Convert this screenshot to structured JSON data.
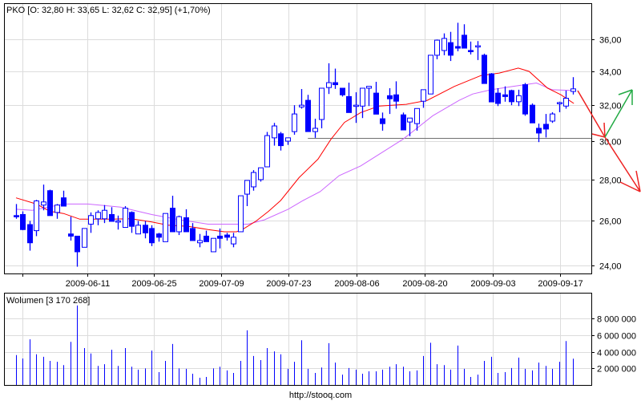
{
  "header": {
    "title": "PKO [O: 32,80  H: 33,65  L: 32,62  C: 32,95] (+1,70%)",
    "volume_title": "Wolumen [3 170 268]",
    "footer": "http://stooq.com"
  },
  "colors": {
    "candle": "#0000ff",
    "ma_short": "#ff0000",
    "ma_long": "#cc66ff",
    "support": "#707070",
    "arrow_down": "#ee2222",
    "arrow_up": "#22aa44",
    "grid": "#dcdcdc"
  },
  "chart_data": [
    {
      "type": "candlestick",
      "title": "PKO",
      "scale": "log",
      "ylim": [
        23.6,
        37.5
      ],
      "y_ticks": [
        {
          "v": 24,
          "label": "24,00"
        },
        {
          "v": 26,
          "label": "26,00"
        },
        {
          "v": 28,
          "label": "28,00"
        },
        {
          "v": 30,
          "label": "30,00"
        },
        {
          "v": 32,
          "label": "32,00"
        },
        {
          "v": 34,
          "label": "34,00"
        },
        {
          "v": 36,
          "label": "36,00"
        }
      ],
      "x_ticks": [
        {
          "i": 0.95,
          "label": ""
        },
        {
          "i": 10.5,
          "label": "2009-06-11"
        },
        {
          "i": 20.3,
          "label": "2009-06-25"
        },
        {
          "i": 30.2,
          "label": "2009-07-09"
        },
        {
          "i": 40.2,
          "label": "2009-07-23"
        },
        {
          "i": 50.2,
          "label": "2009-08-06"
        },
        {
          "i": 60.2,
          "label": "2009-08-20"
        },
        {
          "i": 70.2,
          "label": "2009-09-03"
        },
        {
          "i": 80.2,
          "label": "2009-09-17"
        }
      ],
      "ohlc": [
        [
          26.25,
          26.8,
          26.1,
          26.2
        ],
        [
          26.3,
          26.45,
          25.57,
          25.6
        ],
        [
          25.83,
          26.0,
          24.65,
          25.0
        ],
        [
          25.55,
          27.0,
          25.3,
          26.95
        ],
        [
          26.75,
          27.75,
          26.5,
          26.9
        ],
        [
          27.45,
          27.5,
          26.25,
          26.25
        ],
        [
          26.4,
          26.8,
          26.1,
          26.75
        ],
        [
          27.1,
          27.45,
          26.7,
          26.7
        ],
        [
          25.4,
          26.2,
          25.1,
          25.3
        ],
        [
          25.3,
          25.3,
          23.95,
          24.6
        ],
        [
          24.8,
          25.65,
          24.8,
          25.65
        ],
        [
          25.85,
          26.4,
          25.45,
          26.25
        ],
        [
          26.1,
          26.5,
          25.8,
          26.4
        ],
        [
          26.1,
          26.75,
          25.9,
          26.5
        ],
        [
          26.3,
          26.65,
          25.98,
          25.98
        ],
        [
          26.0,
          26.25,
          25.6,
          26.0
        ],
        [
          25.7,
          26.7,
          25.7,
          26.6
        ],
        [
          26.4,
          26.45,
          25.45,
          25.75
        ],
        [
          25.4,
          26.0,
          25.4,
          25.8
        ],
        [
          25.8,
          26.0,
          25.2,
          25.45
        ],
        [
          25.65,
          25.8,
          24.85,
          25.0
        ],
        [
          25.4,
          25.45,
          25.05,
          25.25
        ],
        [
          25.05,
          26.35,
          25.05,
          26.35
        ],
        [
          26.6,
          27.2,
          25.5,
          25.5
        ],
        [
          25.5,
          26.25,
          25.35,
          26.2
        ],
        [
          26.15,
          26.55,
          25.5,
          25.5
        ],
        [
          25.65,
          25.9,
          25.1,
          25.1
        ],
        [
          25.0,
          25.4,
          24.8,
          25.1
        ],
        [
          25.3,
          25.55,
          25.05,
          25.05
        ],
        [
          24.6,
          25.2,
          24.6,
          25.2
        ],
        [
          25.3,
          25.65,
          24.75,
          25.2
        ],
        [
          25.35,
          25.45,
          25.1,
          25.25
        ],
        [
          24.95,
          25.45,
          24.8,
          25.25
        ],
        [
          25.5,
          27.2,
          25.5,
          27.2
        ],
        [
          27.28,
          27.96,
          26.7,
          27.96
        ],
        [
          27.64,
          28.48,
          27.45,
          28.36
        ],
        [
          28.0,
          28.6,
          27.9,
          28.6
        ],
        [
          28.65,
          30.5,
          28.65,
          30.3
        ],
        [
          30.18,
          31.0,
          29.76,
          30.83
        ],
        [
          30.4,
          30.5,
          29.5,
          29.76
        ],
        [
          30.0,
          30.2,
          29.8,
          30.18
        ],
        [
          30.52,
          32.0,
          30.35,
          31.5
        ],
        [
          31.9,
          32.94,
          31.8,
          32.0
        ],
        [
          32.28,
          32.6,
          30.52,
          30.52
        ],
        [
          30.52,
          31.23,
          30.18,
          30.7
        ],
        [
          31.19,
          32.99,
          30.7,
          32.99
        ],
        [
          33.03,
          34.5,
          32.65,
          33.32
        ],
        [
          33.32,
          34.17,
          32.95,
          33.2
        ],
        [
          32.99,
          32.99,
          32.5,
          32.6
        ],
        [
          32.5,
          33.32,
          31.58,
          31.58
        ],
        [
          32.0,
          32.75,
          31.0,
          32.0
        ],
        [
          31.95,
          32.99,
          31.27,
          32.99
        ],
        [
          32.99,
          33.1,
          31.95,
          33.1
        ],
        [
          32.7,
          33.37,
          31.49,
          31.49
        ],
        [
          31.23,
          31.58,
          30.57,
          30.96
        ],
        [
          32.55,
          32.99,
          31.5,
          32.37
        ],
        [
          32.6,
          33.4,
          31.8,
          32.23
        ],
        [
          31.45,
          31.58,
          30.61,
          30.61
        ],
        [
          31.05,
          31.27,
          30.27,
          31.27
        ],
        [
          30.96,
          31.81,
          30.57,
          31.81
        ],
        [
          32.23,
          32.9,
          31.85,
          32.9
        ],
        [
          32.65,
          35.0,
          32.65,
          35.0
        ],
        [
          35.0,
          36.0,
          34.75,
          35.96
        ],
        [
          35.3,
          36.4,
          35.0,
          36.07
        ],
        [
          35.8,
          36.5,
          34.64,
          35.0
        ],
        [
          35.55,
          37.1,
          35.25,
          35.45
        ],
        [
          36.28,
          37.0,
          35.45,
          35.45
        ],
        [
          35.3,
          35.87,
          35.05,
          35.28
        ],
        [
          35.6,
          35.9,
          34.7,
          35.6
        ],
        [
          35.0,
          35.1,
          33.27,
          33.27
        ],
        [
          33.85,
          33.9,
          32.19,
          32.19
        ],
        [
          32.7,
          32.99,
          31.95,
          32.1
        ],
        [
          32.6,
          33.1,
          32.2,
          32.5
        ],
        [
          32.85,
          32.9,
          32.0,
          32.2
        ],
        [
          32.2,
          32.9,
          31.95,
          32.55
        ],
        [
          33.2,
          33.3,
          31.4,
          31.5
        ],
        [
          32.0,
          32.1,
          31.0,
          31.0
        ],
        [
          30.7,
          30.96,
          29.95,
          30.44
        ],
        [
          30.92,
          31.5,
          30.2,
          30.66
        ],
        [
          31.1,
          31.6,
          31.0,
          31.5
        ],
        [
          32.1,
          32.2,
          31.6,
          32.15
        ],
        [
          31.95,
          32.85,
          31.8,
          32.4
        ],
        [
          32.8,
          33.65,
          32.62,
          32.95
        ]
      ],
      "ma_short": [
        [
          0,
          27.1
        ],
        [
          3,
          26.8
        ],
        [
          5,
          26.45
        ],
        [
          7,
          26.35
        ],
        [
          9.4,
          26.08
        ],
        [
          14,
          26.08
        ],
        [
          17,
          26.1
        ],
        [
          20,
          25.95
        ],
        [
          22.4,
          25.8
        ],
        [
          25.4,
          25.75
        ],
        [
          28.3,
          25.6
        ],
        [
          30.7,
          25.5
        ],
        [
          32.5,
          25.5
        ],
        [
          33.6,
          25.65
        ],
        [
          35.4,
          26.0
        ],
        [
          37.2,
          26.45
        ],
        [
          39,
          26.97
        ],
        [
          41.7,
          28.1
        ],
        [
          44.5,
          29.05
        ],
        [
          46.4,
          30.1
        ],
        [
          48.4,
          31.03
        ],
        [
          50.8,
          31.58
        ],
        [
          53.5,
          31.95
        ],
        [
          57.5,
          32.05
        ],
        [
          60.6,
          32.28
        ],
        [
          64.6,
          33.1
        ],
        [
          68.5,
          33.75
        ],
        [
          71.2,
          33.9
        ],
        [
          74,
          34.2
        ],
        [
          75.6,
          34.0
        ],
        [
          78.3,
          33.0
        ],
        [
          80.3,
          32.6
        ],
        [
          82.2,
          32.1
        ]
      ],
      "ma_long": [
        [
          0,
          26.55
        ],
        [
          2.4,
          26.5
        ],
        [
          7,
          26.8
        ],
        [
          10.6,
          26.8
        ],
        [
          15.4,
          26.65
        ],
        [
          20,
          26.3
        ],
        [
          23.6,
          26.08
        ],
        [
          28.3,
          25.85
        ],
        [
          31.9,
          25.85
        ],
        [
          34.2,
          25.85
        ],
        [
          36.6,
          26.05
        ],
        [
          40.1,
          26.55
        ],
        [
          42.3,
          26.97
        ],
        [
          44.8,
          27.4
        ],
        [
          47.6,
          28.2
        ],
        [
          50.8,
          28.7
        ],
        [
          57,
          30.1
        ],
        [
          61.4,
          31.4
        ],
        [
          65.3,
          32.28
        ],
        [
          67.3,
          32.65
        ],
        [
          70,
          32.9
        ],
        [
          73.2,
          33.1
        ],
        [
          76.7,
          33.3
        ],
        [
          79,
          32.9
        ],
        [
          82.3,
          32.85
        ]
      ],
      "support_level": 30.18,
      "support_from_index": 43
    },
    {
      "type": "bar",
      "title": "Wolumen",
      "unit": "millions of shares",
      "ylim": [
        0,
        10
      ],
      "y_ticks": [
        {
          "v": 2,
          "label": "2 000 000"
        },
        {
          "v": 4,
          "label": "4 000 000"
        },
        {
          "v": 6,
          "label": "6 000 000"
        },
        {
          "v": 8,
          "label": "8 000 000"
        }
      ],
      "values": [
        3.6,
        3.2,
        5.5,
        3.7,
        3.4,
        2.9,
        2.8,
        2.4,
        5.2,
        9.6,
        4.45,
        3.8,
        2.3,
        2.5,
        4.25,
        2.3,
        4.45,
        2.2,
        1.85,
        2.0,
        4.15,
        1.55,
        2.9,
        4.95,
        2.0,
        1.95,
        1.35,
        0.87,
        0.97,
        2.0,
        2.2,
        1.75,
        1.45,
        2.9,
        6.6,
        3.5,
        3.0,
        4.45,
        4.05,
        3.7,
        1.95,
        2.8,
        5.4,
        1.95,
        1.45,
        2.1,
        5.05,
        2.7,
        1.25,
        2.05,
        1.85,
        1.35,
        1.65,
        1.65,
        1.85,
        2.2,
        2.5,
        2.2,
        1.65,
        1.75,
        3.5,
        5.1,
        2.5,
        2.4,
        1.85,
        4.75,
        1.95,
        0.97,
        1.25,
        2.9,
        3.4,
        1.45,
        1.55,
        2.05,
        3.3,
        1.95,
        1.75,
        2.7,
        2.3,
        1.95,
        2.8,
        5.3,
        3.17
      ]
    }
  ]
}
